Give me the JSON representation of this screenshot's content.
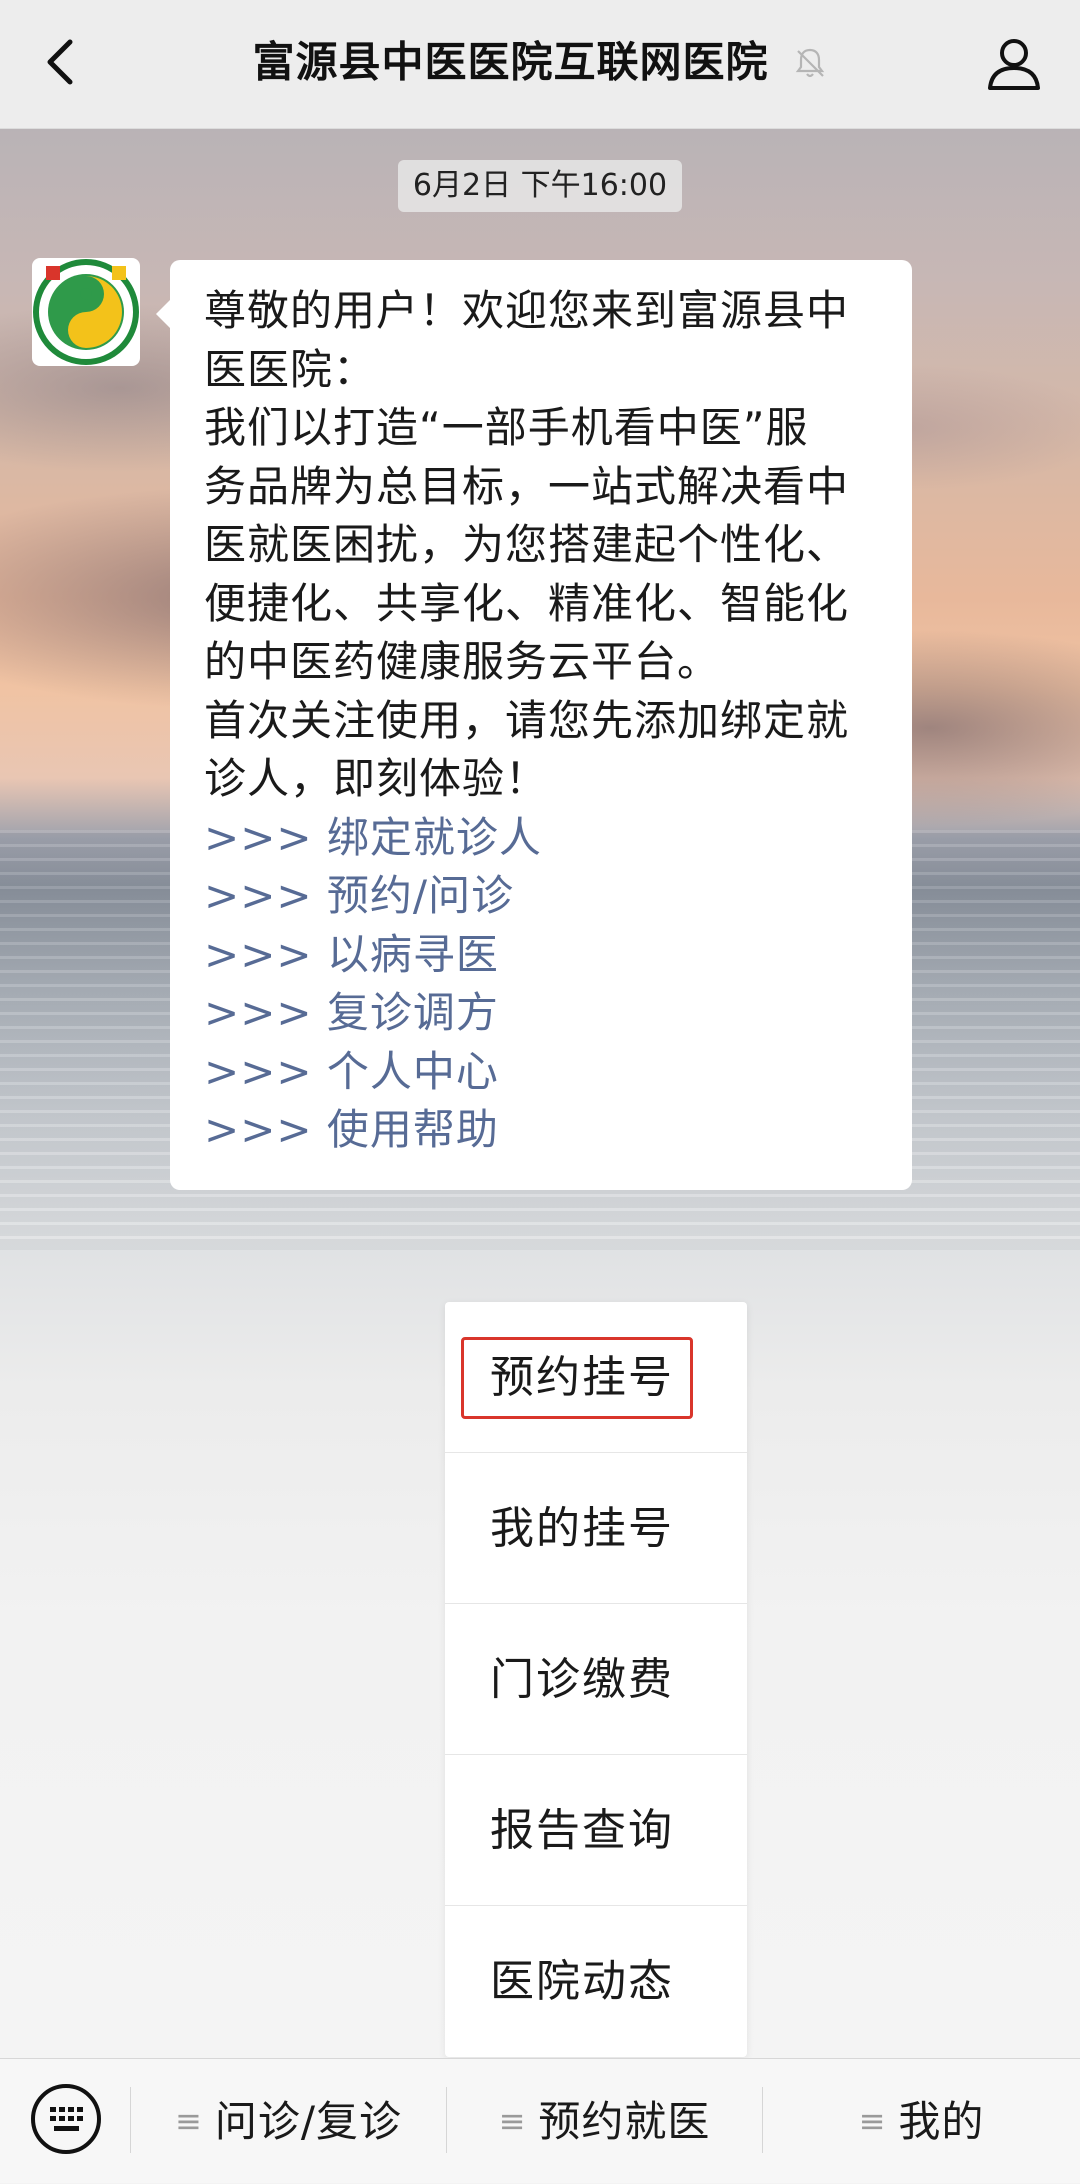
{
  "header": {
    "title": "富源县中医医院互联网医院"
  },
  "chat": {
    "timestamp": "6月2日 下午16:00",
    "message": {
      "text": "尊敬的用户！欢迎您来到富源县中\n医医院：\n我们以打造“一部手机看中医”服\n务品牌为总目标，一站式解决看中\n医就医困扰，为您搭建起个性化、\n便捷化、共享化、精准化、智能化\n的中医药健康服务云平台。\n首次关注使用，请您先添加绑定就\n诊人，即刻体验！",
      "links": [
        ">>> 绑定就诊人",
        ">>> 预约/问诊",
        ">>> 以病寻医",
        ">>> 复诊调方",
        ">>> 个人中心",
        ">>> 使用帮助"
      ]
    }
  },
  "popup_menu": {
    "items": [
      {
        "label": "预约挂号"
      },
      {
        "label": "我的挂号"
      },
      {
        "label": "门诊缴费"
      },
      {
        "label": "报告查询"
      },
      {
        "label": "医院动态"
      }
    ],
    "highlight_color": "#d9352b"
  },
  "bottom_bar": {
    "tabs": [
      {
        "label": "问诊/复诊"
      },
      {
        "label": "预约就医"
      },
      {
        "label": "我的"
      }
    ]
  },
  "colors": {
    "link": "#576b95",
    "header_bg": "#ededed",
    "logo_green": "#1f8a3a"
  },
  "icons": [
    "back-arrow-icon",
    "mute-bell-icon",
    "profile-icon",
    "hospital-logo",
    "keyboard-icon",
    "menu-lines-icon"
  ]
}
